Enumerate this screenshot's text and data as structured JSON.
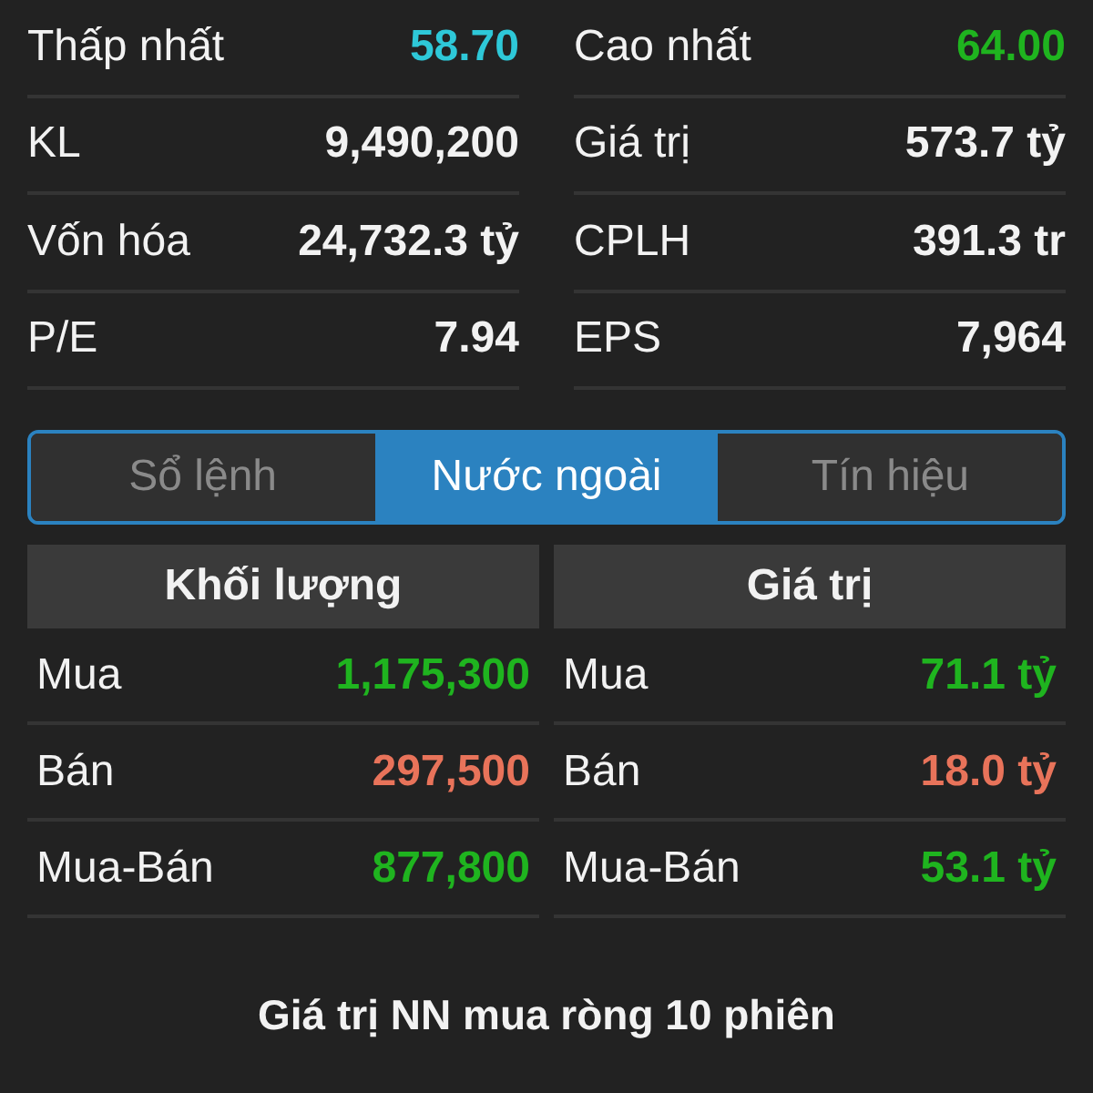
{
  "stats": [
    {
      "label": "Thấp nhất",
      "value": "58.70",
      "color": "#2ec8d8"
    },
    {
      "label": "Cao nhất",
      "value": "64.00",
      "color": "#1fb41f"
    },
    {
      "label": "KL",
      "value": "9,490,200",
      "color": "#f2f2f2"
    },
    {
      "label": "Giá trị",
      "value": "573.7 tỷ",
      "color": "#f2f2f2"
    },
    {
      "label": "Vốn hóa",
      "value": "24,732.3 tỷ",
      "color": "#f2f2f2"
    },
    {
      "label": "CPLH",
      "value": "391.3 tr",
      "color": "#f2f2f2"
    },
    {
      "label": "P/E",
      "value": "7.94",
      "color": "#f2f2f2"
    },
    {
      "label": "EPS",
      "value": "7,964",
      "color": "#f2f2f2"
    }
  ],
  "tabs": [
    {
      "label": "Sổ lệnh",
      "selected": false
    },
    {
      "label": "Nước ngoài",
      "selected": true
    },
    {
      "label": "Tín hiệu",
      "selected": false
    }
  ],
  "panels": [
    {
      "title": "Khối lượng",
      "rows": [
        {
          "label": "Mua",
          "value": "1,175,300",
          "color": "#1fb41f"
        },
        {
          "label": "Bán",
          "value": "297,500",
          "color": "#e8735a"
        },
        {
          "label": "Mua-Bán",
          "value": "877,800",
          "color": "#1fb41f"
        }
      ]
    },
    {
      "title": "Giá trị",
      "rows": [
        {
          "label": "Mua",
          "value": "71.1 tỷ",
          "color": "#1fb41f"
        },
        {
          "label": "Bán",
          "value": "18.0 tỷ",
          "color": "#e8735a"
        },
        {
          "label": "Mua-Bán",
          "value": "53.1 tỷ",
          "color": "#1fb41f"
        }
      ]
    }
  ],
  "footer": "Giá trị NN mua ròng 10 phiên"
}
